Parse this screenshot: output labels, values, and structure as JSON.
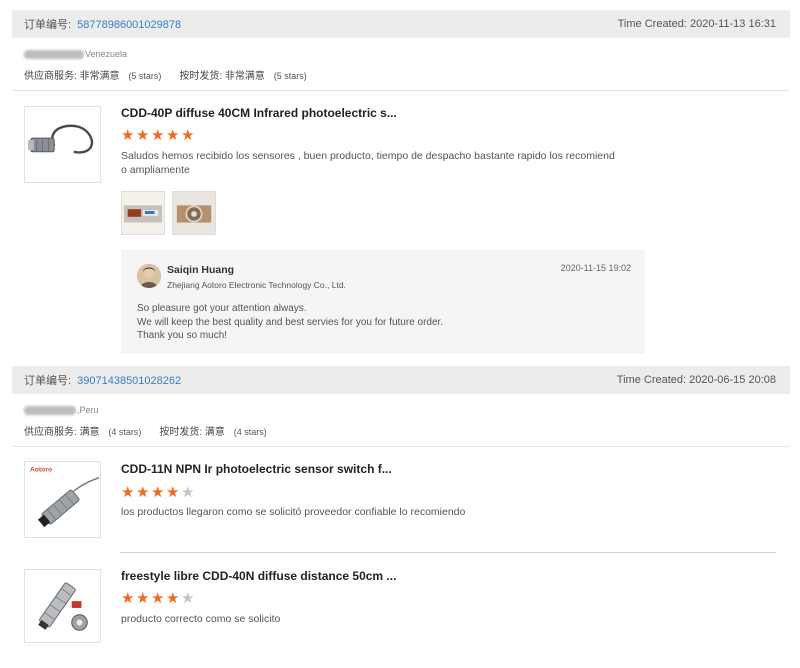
{
  "orders": [
    {
      "number_label": "订单编号:",
      "number": "58778986001029878",
      "time_created": "Time Created: 2020-11-13 16:31",
      "buyer_country": "Venezuela",
      "supplier_service_label": "供应商服务:",
      "supplier_service_value": "非常满意",
      "supplier_service_stars": "(5 stars)",
      "shipping_label": "按时发货:",
      "shipping_value": "非常满意",
      "shipping_stars": "(5 stars)",
      "items": [
        {
          "title": "CDD-40P diffuse 40CM Infrared photoelectric s...",
          "rating": 5,
          "review": "Saludos hemos recibido los sensores , buen producto, tiempo de despacho bastante rapido los recomiend o ampliamente",
          "reply": {
            "name": "Saiqin Huang",
            "company": "Zhejiang Aotoro Electronic Technology Co., Ltd.",
            "date": "2020-11-15 19:02",
            "lines": [
              "So pleasure got your attention always.",
              "We will keep the best quality and best servies for you for future order.",
              "Thank you so much!"
            ]
          }
        }
      ]
    },
    {
      "number_label": "订单编号:",
      "number": "39071438501028262",
      "time_created": "Time Created: 2020-06-15 20:08",
      "buyer_country": ",Peru",
      "supplier_service_label": "供应商服务:",
      "supplier_service_value": "满意",
      "supplier_service_stars": "(4 stars)",
      "shipping_label": "按时发货:",
      "shipping_value": "满意",
      "shipping_stars": "(4 stars)",
      "items": [
        {
          "title": "CDD-11N NPN Ir photoelectric sensor switch f...",
          "brand": "Aotoro",
          "rating": 4,
          "review": "los productos llegaron como se solicitó proveedor confiable lo recomiendo"
        },
        {
          "title": "freestyle libre CDD-40N diffuse distance 50cm ...",
          "rating": 4,
          "review": "producto correcto como se solicito"
        }
      ]
    }
  ],
  "colors": {
    "accent_link": "#3a7cc7",
    "star_on": "#f26b1d",
    "star_off": "#c4c4c4",
    "header_bg": "#ececec"
  }
}
